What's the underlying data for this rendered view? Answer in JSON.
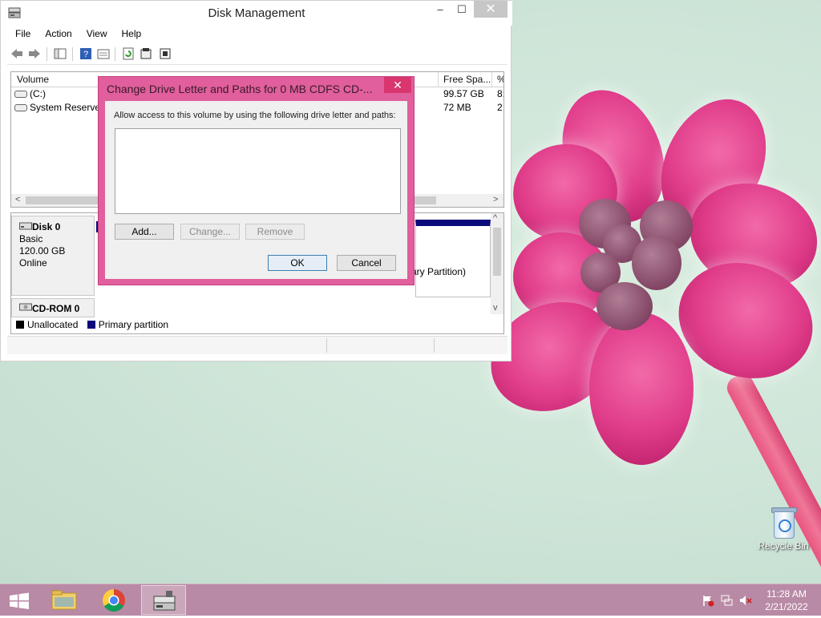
{
  "window": {
    "title": "Disk Management",
    "minimize": "–",
    "maximize": "☐",
    "close": "✕"
  },
  "menu": [
    "File",
    "Action",
    "View",
    "Help"
  ],
  "volume_list": {
    "columns": [
      "Volume",
      "Free Spa...",
      "%"
    ],
    "rows": [
      {
        "name": "(C:)",
        "free": "99.57 GB",
        "pct": "8:"
      },
      {
        "name": "System Reserved",
        "free": "72 MB",
        "pct": "2"
      }
    ]
  },
  "disks": [
    {
      "name": "Disk 0",
      "type": "Basic",
      "size": "120.00 GB",
      "status": "Online"
    },
    {
      "name": "CD-ROM 0"
    }
  ],
  "partition_text": "ary Partition)",
  "legend": [
    {
      "label": "Unallocated",
      "color": "#000000"
    },
    {
      "label": "Primary partition",
      "color": "#0a0a7a"
    }
  ],
  "dialog": {
    "title": "Change Drive Letter and Paths for 0 MB CDFS  CD-...",
    "close": "✕",
    "prompt": "Allow access to this volume by using the following drive letter and paths:",
    "buttons": {
      "add": "Add...",
      "change": "Change...",
      "remove": "Remove",
      "ok": "OK",
      "cancel": "Cancel"
    }
  },
  "desktop": {
    "recycle_bin": "Recycle Bin"
  },
  "taskbar": {
    "time": "11:28 AM",
    "date": "2/21/2022"
  },
  "colors": {
    "dialog_frame": "#e05f9c",
    "taskbar": "#b98aa5",
    "primary_partition": "#0a0a7a"
  }
}
